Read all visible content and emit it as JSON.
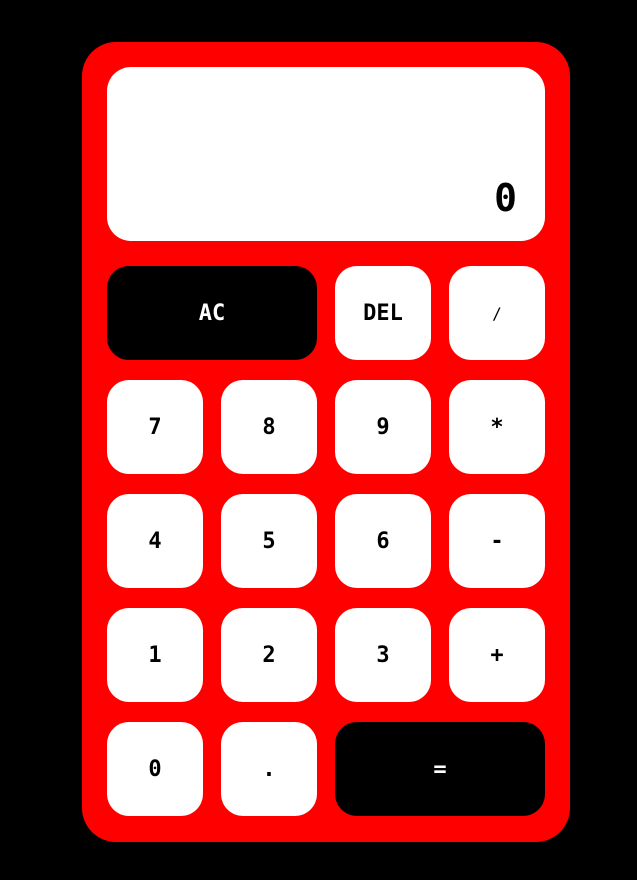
{
  "display": {
    "value": "0"
  },
  "keys": {
    "clear": "AC",
    "delete": "DEL",
    "divide": "/",
    "seven": "7",
    "eight": "8",
    "nine": "9",
    "multiply": "*",
    "four": "4",
    "five": "5",
    "six": "6",
    "minus": "-",
    "one": "1",
    "two": "2",
    "three": "3",
    "plus": "+",
    "zero": "0",
    "decimal": ".",
    "equals": "="
  },
  "colors": {
    "background": "#000000",
    "body": "#ff0000",
    "key": "#ffffff",
    "key_dark": "#000000"
  }
}
